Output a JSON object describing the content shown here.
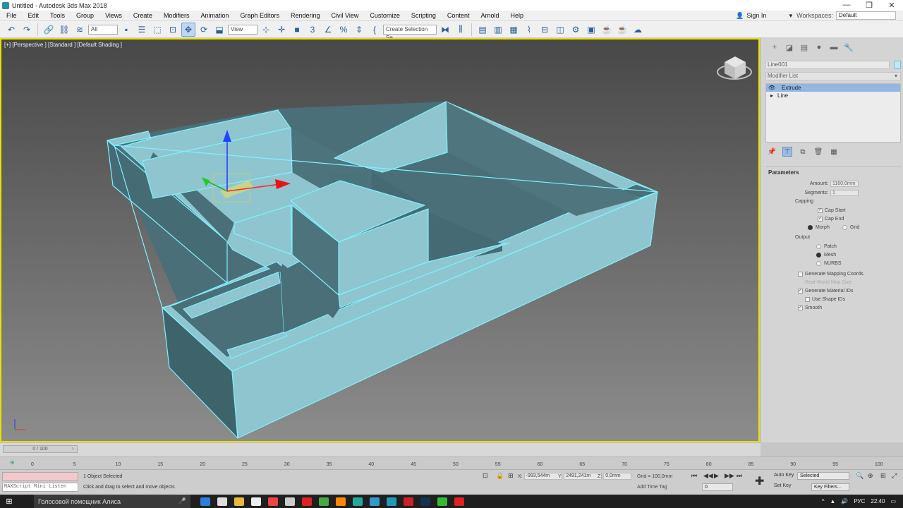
{
  "window": {
    "title": "Untitled - Autodesk 3ds Max 2018",
    "minimize": "—",
    "restore": "❐",
    "close": "✕"
  },
  "menu": {
    "items": [
      "File",
      "Edit",
      "Tools",
      "Group",
      "Views",
      "Create",
      "Modifiers",
      "Animation",
      "Graph Editors",
      "Rendering",
      "Civil View",
      "Customize",
      "Scripting",
      "Content",
      "Arnold",
      "Help"
    ],
    "sign_in": "Sign In",
    "workspaces_label": "Workspaces:",
    "workspaces_value": "Default"
  },
  "toolbar": {
    "filter_value": "All",
    "ref_coord_value": "View",
    "named_selection_placeholder": "Create Selection Se"
  },
  "viewport": {
    "label": "[+] [Perspective ] [Standard ] [Default Shading ]",
    "object_color": "#8fc5cf",
    "highlight_color": "#7ff1ff",
    "border_color": "#e8e000"
  },
  "command_panel": {
    "object_name": "Line001",
    "object_color": "#aef4f4",
    "modifier_list": "Modifier List",
    "stack": [
      {
        "label": "Extrude",
        "selected": true
      },
      {
        "label": "Line",
        "selected": false
      }
    ],
    "params_title": "Parameters",
    "amount_label": "Amount:",
    "amount_value": "1160,0mm",
    "segments_label": "Segments:",
    "segments_value": "1",
    "capping_label": "Capping",
    "cap_start": "Cap Start",
    "cap_end": "Cap End",
    "morph": "Morph",
    "grid_opt": "Grid",
    "output_label": "Output",
    "patch": "Patch",
    "mesh": "Mesh",
    "nurbs": "NURBS",
    "gen_mapping": "Generate Mapping Coords.",
    "real_world": "Real-World Map Size",
    "gen_matids": "Generate Material IDs",
    "use_shape_ids": "Use Shape IDs",
    "smooth": "Smooth"
  },
  "timeline": {
    "slider_label": "0 / 100",
    "ticks": [
      "0",
      "5",
      "10",
      "15",
      "20",
      "25",
      "30",
      "35",
      "40",
      "45",
      "50",
      "55",
      "60",
      "65",
      "70",
      "75",
      "80",
      "85",
      "90",
      "95",
      "100"
    ]
  },
  "status": {
    "maxscript": "MAXScript Mini Listen",
    "selected_msg": "1 Object Selected",
    "hint_msg": "Click and drag to select and move objects",
    "x_label": "X:",
    "x_value": "-993,544m",
    "y_label": "Y:",
    "y_value": "2491,241m",
    "z_label": "Z:",
    "z_value": "0,0mm",
    "grid": "Grid = 100,0mm",
    "add_time_tag": "Add Time Tag",
    "auto_key": "Auto Key",
    "set_key": "Set Key",
    "selected_value": "Selected",
    "key_filters": "Key Filters...",
    "frame_value": "0"
  },
  "taskbar": {
    "search_text": "Голосовой помощник Алиса",
    "lang": "РУС",
    "time": "22:40"
  }
}
